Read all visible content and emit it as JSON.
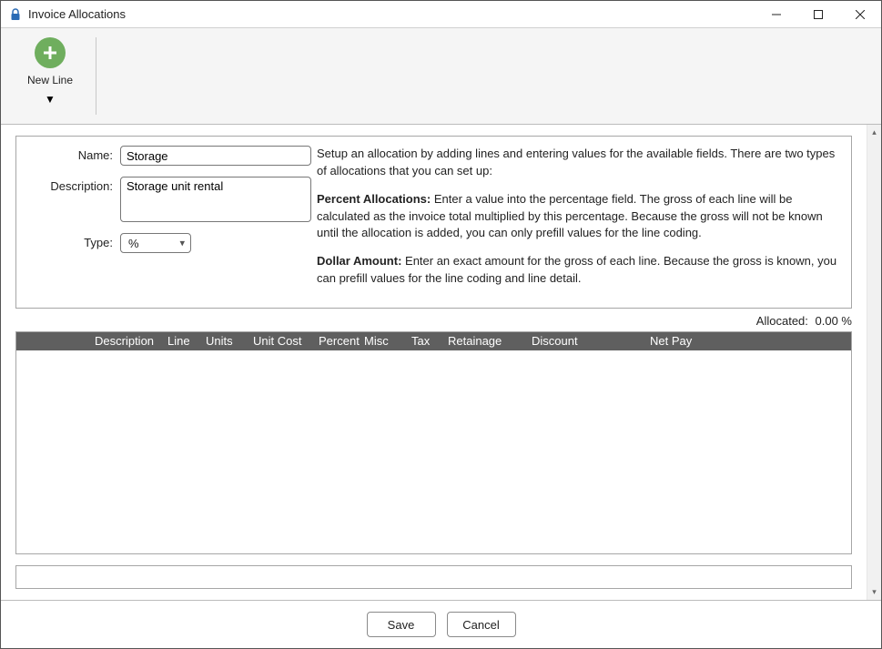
{
  "window": {
    "title": "Invoice Allocations"
  },
  "toolbar": {
    "new_line_label": "New Line"
  },
  "form": {
    "name_label": "Name:",
    "name_value": "Storage",
    "description_label": "Description:",
    "description_value": "Storage unit rental",
    "type_label": "Type:",
    "type_value": "%"
  },
  "help": {
    "intro": "Setup an allocation by adding lines and entering values for the available fields. There are two types of allocations that you can set up:",
    "percent_title": "Percent Allocations:",
    "percent_body": " Enter a value into the percentage field. The gross of each line will be calculated as the invoice total multiplied by this percentage. Because the gross will not be known until the allocation is added, you can only prefill values for the line coding.",
    "dollar_title": "Dollar Amount:",
    "dollar_body": " Enter an exact amount for the gross of each line. Because the gross is known, you can prefill values for the line coding and line detail."
  },
  "allocated": {
    "label": "Allocated:",
    "value": "0.00 %"
  },
  "grid": {
    "columns": {
      "description": "Description",
      "line": "Line",
      "units": "Units",
      "unit_cost": "Unit Cost",
      "percent": "Percent",
      "misc": "Misc",
      "tax": "Tax",
      "retainage": "Retainage",
      "discount": "Discount",
      "net_pay": "Net Pay"
    }
  },
  "footer": {
    "save": "Save",
    "cancel": "Cancel"
  }
}
